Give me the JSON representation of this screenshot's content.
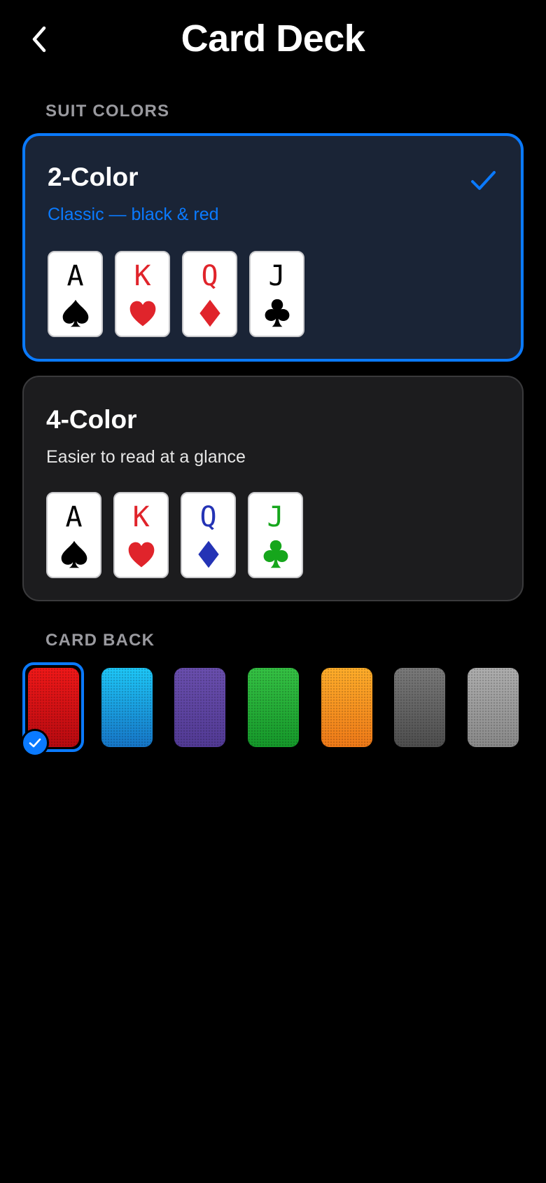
{
  "header": {
    "title": "Card Deck",
    "back_icon": "chevron-left-icon"
  },
  "suit_colors": {
    "section_label": "SUIT COLORS",
    "options": [
      {
        "title": "2-Color",
        "subtitle": "Classic — black & red",
        "selected": true,
        "cards": [
          {
            "rank": "A",
            "suit": "spade",
            "color": "#000000"
          },
          {
            "rank": "K",
            "suit": "heart",
            "color": "#e0242b"
          },
          {
            "rank": "Q",
            "suit": "diamond",
            "color": "#e0242b"
          },
          {
            "rank": "J",
            "suit": "club",
            "color": "#000000"
          }
        ]
      },
      {
        "title": "4-Color",
        "subtitle": "Easier to read at a glance",
        "selected": false,
        "cards": [
          {
            "rank": "A",
            "suit": "spade",
            "color": "#000000"
          },
          {
            "rank": "K",
            "suit": "heart",
            "color": "#e0242b"
          },
          {
            "rank": "Q",
            "suit": "diamond",
            "color": "#2433b5"
          },
          {
            "rank": "J",
            "suit": "club",
            "color": "#16a61c"
          }
        ]
      }
    ]
  },
  "card_back": {
    "section_label": "CARD BACK",
    "selected_index": 0,
    "backs": [
      {
        "name": "red",
        "top": "#f01818",
        "bottom": "#b80a10"
      },
      {
        "name": "blue",
        "top": "#1ec8f8",
        "bottom": "#1676c8"
      },
      {
        "name": "purple",
        "top": "#6a4fae",
        "bottom": "#523a95"
      },
      {
        "name": "green",
        "top": "#35c244",
        "bottom": "#15992a"
      },
      {
        "name": "orange",
        "top": "#ffae2a",
        "bottom": "#f07a18"
      },
      {
        "name": "dark-gray",
        "top": "#7a7a7a",
        "bottom": "#4e4e4e"
      },
      {
        "name": "light-gray",
        "top": "#aeaeae",
        "bottom": "#8a8a8a"
      }
    ]
  },
  "colors": {
    "accent": "#0a7aff",
    "background": "#000000"
  }
}
